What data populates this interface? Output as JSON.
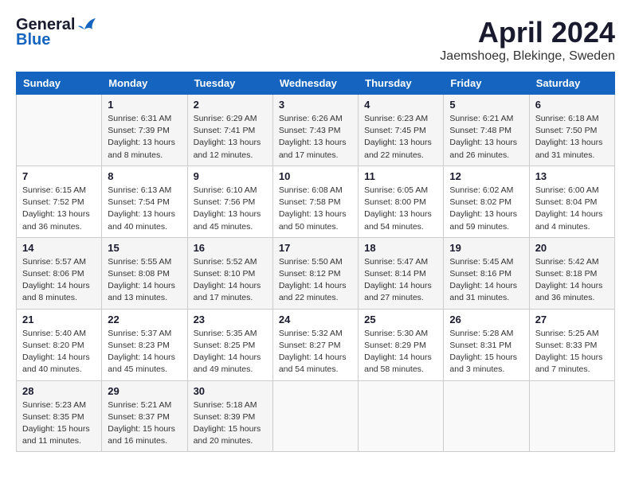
{
  "header": {
    "logo_general": "General",
    "logo_blue": "Blue",
    "month_title": "April 2024",
    "location": "Jaemshoeg, Blekinge, Sweden"
  },
  "weekdays": [
    "Sunday",
    "Monday",
    "Tuesday",
    "Wednesday",
    "Thursday",
    "Friday",
    "Saturday"
  ],
  "weeks": [
    [
      {
        "day": "",
        "info": ""
      },
      {
        "day": "1",
        "info": "Sunrise: 6:31 AM\nSunset: 7:39 PM\nDaylight: 13 hours\nand 8 minutes."
      },
      {
        "day": "2",
        "info": "Sunrise: 6:29 AM\nSunset: 7:41 PM\nDaylight: 13 hours\nand 12 minutes."
      },
      {
        "day": "3",
        "info": "Sunrise: 6:26 AM\nSunset: 7:43 PM\nDaylight: 13 hours\nand 17 minutes."
      },
      {
        "day": "4",
        "info": "Sunrise: 6:23 AM\nSunset: 7:45 PM\nDaylight: 13 hours\nand 22 minutes."
      },
      {
        "day": "5",
        "info": "Sunrise: 6:21 AM\nSunset: 7:48 PM\nDaylight: 13 hours\nand 26 minutes."
      },
      {
        "day": "6",
        "info": "Sunrise: 6:18 AM\nSunset: 7:50 PM\nDaylight: 13 hours\nand 31 minutes."
      }
    ],
    [
      {
        "day": "7",
        "info": "Sunrise: 6:15 AM\nSunset: 7:52 PM\nDaylight: 13 hours\nand 36 minutes."
      },
      {
        "day": "8",
        "info": "Sunrise: 6:13 AM\nSunset: 7:54 PM\nDaylight: 13 hours\nand 40 minutes."
      },
      {
        "day": "9",
        "info": "Sunrise: 6:10 AM\nSunset: 7:56 PM\nDaylight: 13 hours\nand 45 minutes."
      },
      {
        "day": "10",
        "info": "Sunrise: 6:08 AM\nSunset: 7:58 PM\nDaylight: 13 hours\nand 50 minutes."
      },
      {
        "day": "11",
        "info": "Sunrise: 6:05 AM\nSunset: 8:00 PM\nDaylight: 13 hours\nand 54 minutes."
      },
      {
        "day": "12",
        "info": "Sunrise: 6:02 AM\nSunset: 8:02 PM\nDaylight: 13 hours\nand 59 minutes."
      },
      {
        "day": "13",
        "info": "Sunrise: 6:00 AM\nSunset: 8:04 PM\nDaylight: 14 hours\nand 4 minutes."
      }
    ],
    [
      {
        "day": "14",
        "info": "Sunrise: 5:57 AM\nSunset: 8:06 PM\nDaylight: 14 hours\nand 8 minutes."
      },
      {
        "day": "15",
        "info": "Sunrise: 5:55 AM\nSunset: 8:08 PM\nDaylight: 14 hours\nand 13 minutes."
      },
      {
        "day": "16",
        "info": "Sunrise: 5:52 AM\nSunset: 8:10 PM\nDaylight: 14 hours\nand 17 minutes."
      },
      {
        "day": "17",
        "info": "Sunrise: 5:50 AM\nSunset: 8:12 PM\nDaylight: 14 hours\nand 22 minutes."
      },
      {
        "day": "18",
        "info": "Sunrise: 5:47 AM\nSunset: 8:14 PM\nDaylight: 14 hours\nand 27 minutes."
      },
      {
        "day": "19",
        "info": "Sunrise: 5:45 AM\nSunset: 8:16 PM\nDaylight: 14 hours\nand 31 minutes."
      },
      {
        "day": "20",
        "info": "Sunrise: 5:42 AM\nSunset: 8:18 PM\nDaylight: 14 hours\nand 36 minutes."
      }
    ],
    [
      {
        "day": "21",
        "info": "Sunrise: 5:40 AM\nSunset: 8:20 PM\nDaylight: 14 hours\nand 40 minutes."
      },
      {
        "day": "22",
        "info": "Sunrise: 5:37 AM\nSunset: 8:23 PM\nDaylight: 14 hours\nand 45 minutes."
      },
      {
        "day": "23",
        "info": "Sunrise: 5:35 AM\nSunset: 8:25 PM\nDaylight: 14 hours\nand 49 minutes."
      },
      {
        "day": "24",
        "info": "Sunrise: 5:32 AM\nSunset: 8:27 PM\nDaylight: 14 hours\nand 54 minutes."
      },
      {
        "day": "25",
        "info": "Sunrise: 5:30 AM\nSunset: 8:29 PM\nDaylight: 14 hours\nand 58 minutes."
      },
      {
        "day": "26",
        "info": "Sunrise: 5:28 AM\nSunset: 8:31 PM\nDaylight: 15 hours\nand 3 minutes."
      },
      {
        "day": "27",
        "info": "Sunrise: 5:25 AM\nSunset: 8:33 PM\nDaylight: 15 hours\nand 7 minutes."
      }
    ],
    [
      {
        "day": "28",
        "info": "Sunrise: 5:23 AM\nSunset: 8:35 PM\nDaylight: 15 hours\nand 11 minutes."
      },
      {
        "day": "29",
        "info": "Sunrise: 5:21 AM\nSunset: 8:37 PM\nDaylight: 15 hours\nand 16 minutes."
      },
      {
        "day": "30",
        "info": "Sunrise: 5:18 AM\nSunset: 8:39 PM\nDaylight: 15 hours\nand 20 minutes."
      },
      {
        "day": "",
        "info": ""
      },
      {
        "day": "",
        "info": ""
      },
      {
        "day": "",
        "info": ""
      },
      {
        "day": "",
        "info": ""
      }
    ]
  ]
}
